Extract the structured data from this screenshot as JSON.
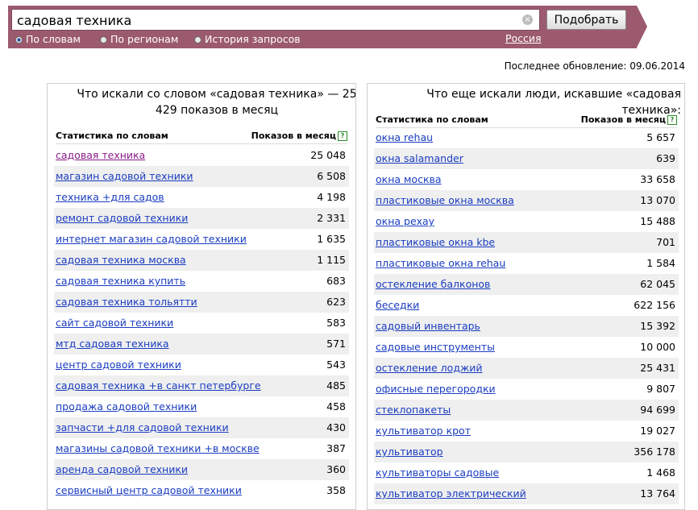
{
  "search": {
    "query": "садовая техника",
    "submit_label": "Подобрать",
    "clear_glyph": "×"
  },
  "modes": [
    {
      "label": "По словам",
      "selected": true
    },
    {
      "label": "По регионам",
      "selected": false
    },
    {
      "label": "История запросов",
      "selected": false
    }
  ],
  "region_label": "Россия",
  "last_update": "Последнее обновление: 09.06.2014",
  "left_panel": {
    "title": "Что искали со словом «садовая техника» — 25 429 показов в месяц",
    "col_query": "Статистика по словам",
    "col_count": "Показов в месяц",
    "help_glyph": "?",
    "rows": [
      {
        "q": "садовая техника",
        "n": "25 048",
        "visited": true
      },
      {
        "q": "магазин садовой техники",
        "n": "6 508"
      },
      {
        "q": "техника +для садов",
        "n": "4 198"
      },
      {
        "q": "ремонт садовой техники",
        "n": "2 331"
      },
      {
        "q": "интернет магазин садовой техники",
        "n": "1 635"
      },
      {
        "q": "садовая техника москва",
        "n": "1 115"
      },
      {
        "q": "садовая техника купить",
        "n": "683"
      },
      {
        "q": "садовая техника тольятти",
        "n": "623"
      },
      {
        "q": "сайт садовой техники",
        "n": "583"
      },
      {
        "q": "мтд садовая техника",
        "n": "571"
      },
      {
        "q": "центр садовой техники",
        "n": "543"
      },
      {
        "q": "садовая техника +в санкт петербурге",
        "n": "485"
      },
      {
        "q": "продажа садовой техники",
        "n": "458"
      },
      {
        "q": "запчасти +для садовой техники",
        "n": "430"
      },
      {
        "q": "магазины садовой техники +в москве",
        "n": "387"
      },
      {
        "q": "аренда садовой техники",
        "n": "360"
      },
      {
        "q": "сервисный центр садовой техники",
        "n": "358"
      }
    ]
  },
  "right_panel": {
    "title": "Что еще искали люди, искавшие «садовая техника»:",
    "col_query": "Статистика по словам",
    "col_count": "Показов в месяц",
    "help_glyph": "?",
    "rows": [
      {
        "q": "окна rehau",
        "n": "5 657"
      },
      {
        "q": "окна salamander",
        "n": "639"
      },
      {
        "q": "окна москва",
        "n": "33 658"
      },
      {
        "q": "пластиковые окна москва",
        "n": "13 070"
      },
      {
        "q": "окна рехау",
        "n": "15 488"
      },
      {
        "q": "пластиковые окна kbe",
        "n": "701"
      },
      {
        "q": "пластиковые окна rehau",
        "n": "1 584"
      },
      {
        "q": "остекление балконов",
        "n": "62 045"
      },
      {
        "q": "беседки",
        "n": "622 156"
      },
      {
        "q": "садовый инвентарь",
        "n": "15 392"
      },
      {
        "q": "садовые инструменты",
        "n": "10 000"
      },
      {
        "q": "остекление лоджий",
        "n": "25 431"
      },
      {
        "q": "офисные перегородки",
        "n": "9 807"
      },
      {
        "q": "стеклопакеты",
        "n": "94 699"
      },
      {
        "q": "культиватор крот",
        "n": "19 027"
      },
      {
        "q": "культиватор",
        "n": "356 178"
      },
      {
        "q": "культиваторы садовые",
        "n": "1 468"
      },
      {
        "q": "культиватор электрический",
        "n": "13 764"
      }
    ]
  }
}
